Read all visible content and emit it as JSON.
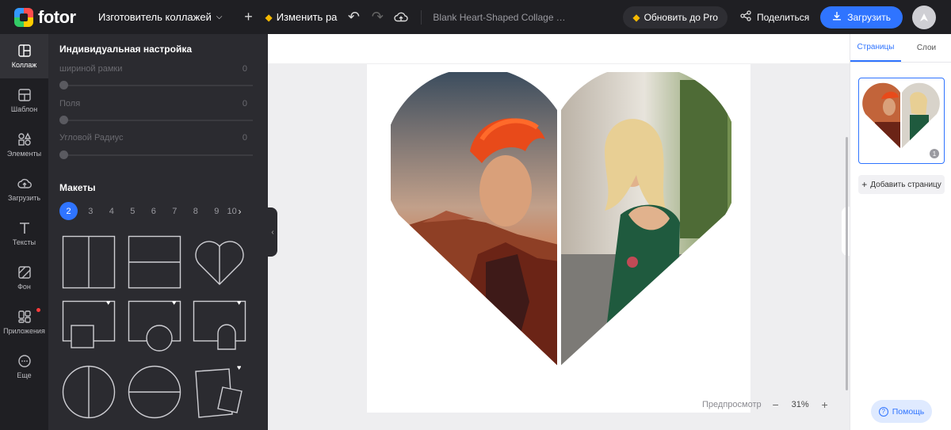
{
  "topbar": {
    "brand": "fotor",
    "mode_dropdown": "Изготовитель коллажей",
    "resize_label": "Изменить ра",
    "doc_title": "Blank Heart-Shaped Collage T...",
    "upgrade_label": "Обновить до Pro",
    "share_label": "Поделиться",
    "upload_label": "Загрузить"
  },
  "rail": {
    "items": [
      {
        "label": "Коллаж",
        "icon": "collage-icon"
      },
      {
        "label": "Шаблон",
        "icon": "template-icon"
      },
      {
        "label": "Элементы",
        "icon": "elements-icon"
      },
      {
        "label": "Загрузить",
        "icon": "cloud-upload-icon"
      },
      {
        "label": "Тексты",
        "icon": "text-icon"
      },
      {
        "label": "Фон",
        "icon": "background-icon"
      },
      {
        "label": "Приложения",
        "icon": "apps-icon"
      },
      {
        "label": "Еще",
        "icon": "more-icon"
      }
    ]
  },
  "panel": {
    "title": "Индивидуальная настройка",
    "sliders": [
      {
        "label": "шириной рамки",
        "value": "0"
      },
      {
        "label": "Поля",
        "value": "0"
      },
      {
        "label": "Угловой Радиус",
        "value": "0"
      }
    ],
    "layouts_title": "Макеты",
    "pages": [
      "2",
      "3",
      "4",
      "5",
      "6",
      "7",
      "8",
      "9",
      "10"
    ],
    "active_page": "2"
  },
  "canvas": {
    "preview_label": "Предпросмотр",
    "zoom": "31%"
  },
  "right_panel": {
    "tabs": [
      "Страницы",
      "Слои"
    ],
    "page_number": "1",
    "add_page_label": "Добавить страницу",
    "help_label": "Помощь"
  },
  "colors": {
    "accent": "#2f74ff",
    "dark_bg": "#1f1f23",
    "panel_bg": "#2b2b30",
    "pro_gold": "#f5b800"
  }
}
